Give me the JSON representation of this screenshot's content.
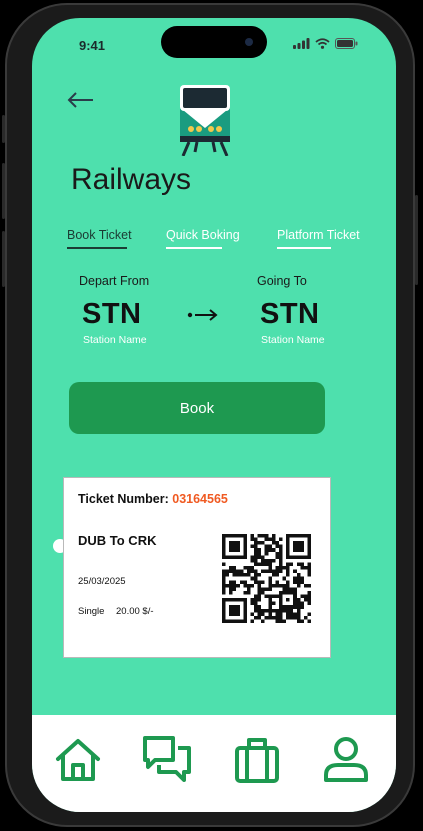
{
  "status_bar": {
    "time": "9:41"
  },
  "header": {
    "title": "Railways"
  },
  "tabs": [
    {
      "label": "Book Ticket",
      "active": true
    },
    {
      "label": "Quick Boking",
      "active": false
    },
    {
      "label": "Platform Ticket",
      "active": false
    }
  ],
  "journey": {
    "depart": {
      "label": "Depart From",
      "code": "STN",
      "subtitle": "Station Name"
    },
    "arrive": {
      "label": "Going To",
      "code": "STN",
      "subtitle": "Station Name"
    }
  },
  "book_button": {
    "label": "Book"
  },
  "ticket": {
    "number_label": "Ticket Number:",
    "number": "03164565",
    "route": "DUB To CRK",
    "date": "25/03/2025",
    "type": "Single",
    "price": "20.00 $/-"
  },
  "navbar": {
    "items": [
      "home-icon",
      "chat-icon",
      "luggage-icon",
      "profile-icon"
    ]
  },
  "colors": {
    "background": "#4ee0ad",
    "accent": "#1e9950",
    "ticket_number": "#f05a22"
  }
}
